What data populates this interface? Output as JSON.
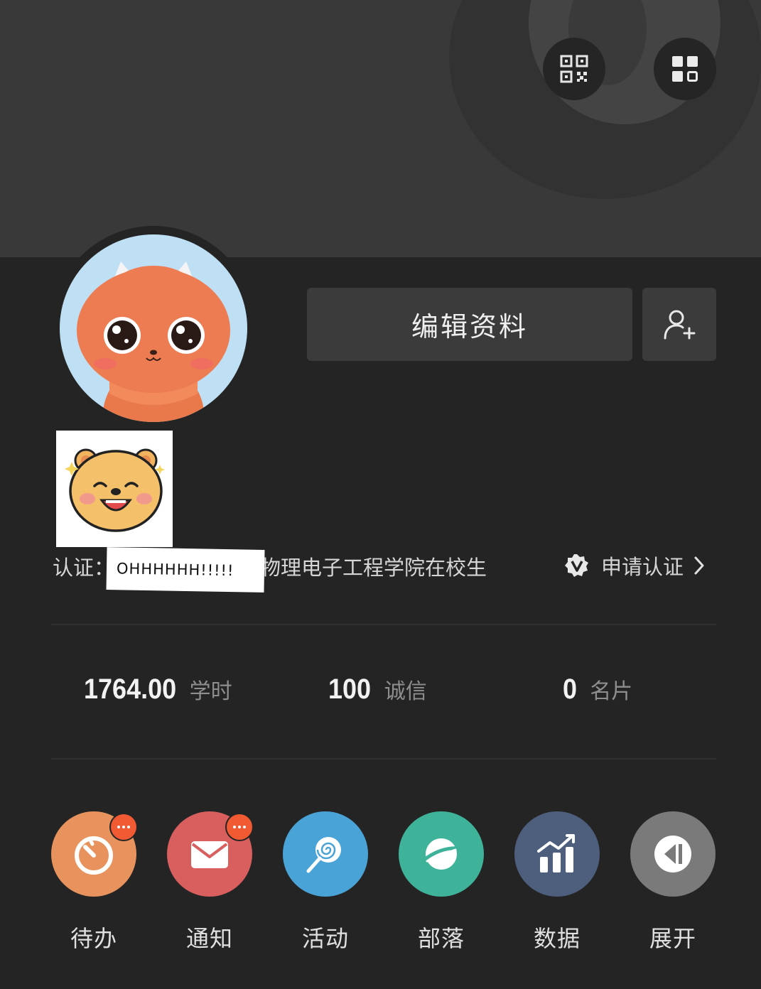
{
  "header": {
    "qr_icon": "qr-code-icon",
    "grid_icon": "grid-apps-icon"
  },
  "profile": {
    "edit_button_label": "编辑资料",
    "add_friend_icon": "person-add-icon",
    "certification": {
      "prefix": "认证：",
      "overlay_text": "OHHHHHH!!!!!",
      "suffix": "物理电子工程学院在校生",
      "apply_label": "申请认证",
      "apply_icon": "verified-v-icon",
      "chevron_icon": "chevron-right-icon"
    }
  },
  "stats": [
    {
      "value": "1764.00",
      "label": "学时"
    },
    {
      "value": "100",
      "label": "诚信"
    },
    {
      "value": "0",
      "label": "名片"
    }
  ],
  "menu": [
    {
      "label": "待办",
      "icon": "timer-icon",
      "color": "#e8935e",
      "badge": true
    },
    {
      "label": "通知",
      "icon": "envelope-icon",
      "color": "#d95f5f",
      "badge": true
    },
    {
      "label": "活动",
      "icon": "lollipop-icon",
      "color": "#4aa3d6",
      "badge": false
    },
    {
      "label": "部落",
      "icon": "planet-icon",
      "color": "#3fb39a",
      "badge": false
    },
    {
      "label": "数据",
      "icon": "chart-trend-icon",
      "color": "#4e5f7e",
      "badge": false
    },
    {
      "label": "展开",
      "icon": "expand-arrow-icon",
      "color": "#7a7a7a",
      "badge": false
    }
  ],
  "colors": {
    "background": "#242424",
    "banner": "#393939",
    "badge": "#f15a32"
  }
}
